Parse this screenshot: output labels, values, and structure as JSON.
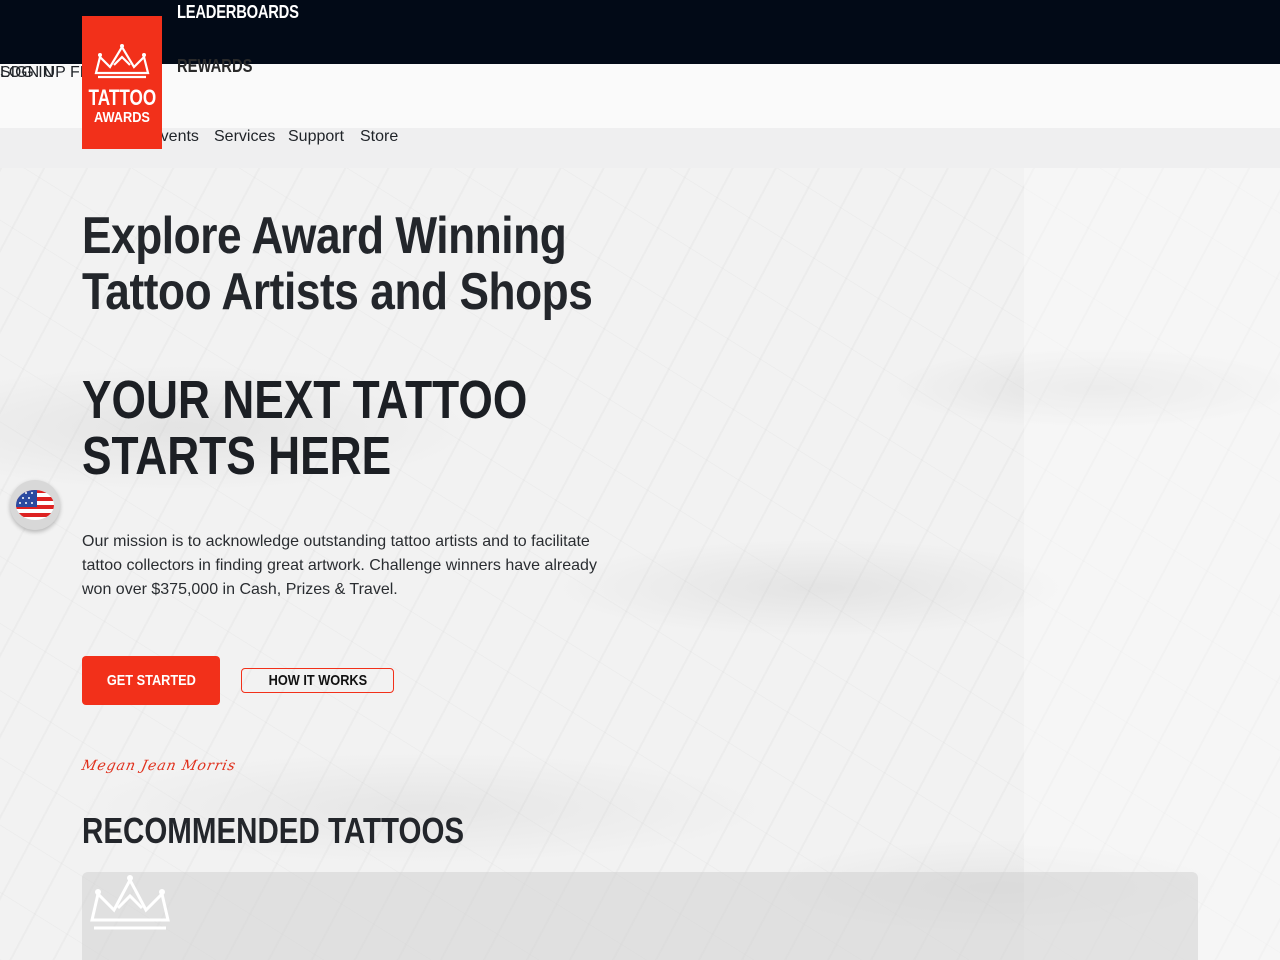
{
  "topbar": {
    "leaderboards": "LEADERBOARDS",
    "rewards": "REWARDS"
  },
  "account": {
    "signup": "SIGN UP FREE",
    "login": "LOG IN"
  },
  "logo": {
    "line1": "TATTOO",
    "line2": "AWARDS"
  },
  "nav": {
    "items": [
      "Events",
      "Services",
      "Support",
      "Store"
    ]
  },
  "hero": {
    "title": "Explore Award Winning Tattoo Artists and Shops",
    "tagline": "YOUR NEXT TATTOO STARTS HERE",
    "mission": "Our mission is to acknowledge outstanding tattoo artists and to facilitate tattoo collectors in finding great artwork. Challenge winners have already won over $375,000 in Cash, Prizes & Travel.",
    "cta_primary": "GET STARTED",
    "cta_secondary": "HOW IT WORKS",
    "signature": "Megan Jean Morris"
  },
  "recommended": {
    "title": "RECOMMENDED TATTOOS"
  },
  "icons": {
    "language": "us-flag-icon",
    "crown": "crown-icon"
  },
  "colors": {
    "accent": "#f2301a",
    "topbar": "#020a17",
    "text": "#23262b"
  }
}
